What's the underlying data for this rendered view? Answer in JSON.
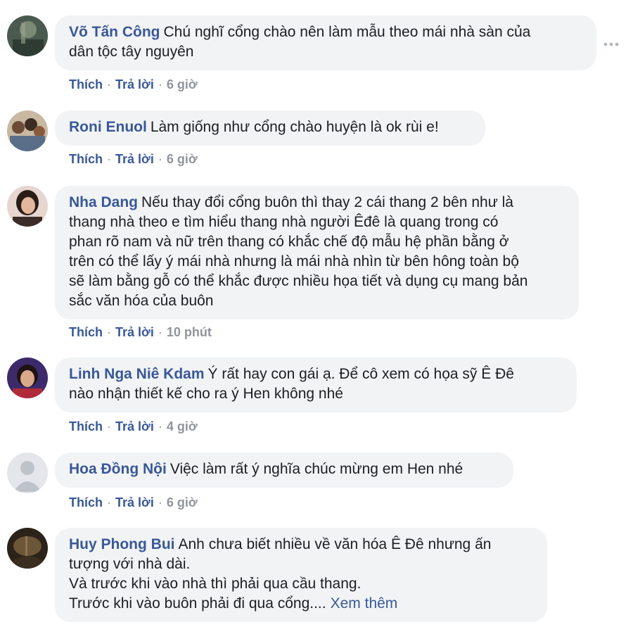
{
  "icons": {
    "more": "more-options-icon"
  },
  "colors": {
    "author": "#385898",
    "bubble": "#f2f3f5",
    "meta": "#90949c"
  },
  "comments": [
    {
      "author": "Võ Tấn Công",
      "text": "Chú nghĩ cổng chào nên làm mẫu theo mái nhà sàn của\ndân tộc tây nguyên",
      "like": "Thích",
      "reply": "Trả lời",
      "time": "6 giờ"
    },
    {
      "author": "Roni Enuol",
      "text": "Làm giống như cổng chào huyện là ok rùi e!",
      "like": "Thích",
      "reply": "Trả lời",
      "time": "6 giờ"
    },
    {
      "author": "Nha Dang",
      "text": "Nếu thay đổi cổng buôn thì thay 2 cái thang 2 bên như là\nthang nhà theo e tìm hiểu thang nhà người Êđê là quang trong có\nphan rõ nam và nữ trên thang có khắc chế độ mẫu hệ phần bằng ở\ntrên có thể lấy ý mái nhà nhưng là mái nhà nhìn từ bên hông toàn bộ\nsẽ làm bằng gỗ có thể khắc được nhiều họa tiết và dụng cụ mang bản\nsắc văn hóa của buôn",
      "like": "Thích",
      "reply": "Trả lời",
      "time": "10 phút"
    },
    {
      "author": "Linh Nga Niê Kdam",
      "text": "Ý rất hay con gái ạ. Để cô xem có họa sỹ Ê Đê\nnào nhận thiết kế cho ra ý Hen không nhé",
      "like": "Thích",
      "reply": "Trả lời",
      "time": "4 giờ"
    },
    {
      "author": "Hoa Đồng Nội",
      "text": "Việc làm rất ý nghĩa chúc mừng em Hen nhé",
      "like": "Thích",
      "reply": "Trả lời",
      "time": "6 giờ"
    },
    {
      "author": "Huy Phong Bui",
      "text": "Anh chưa biết nhiều về văn hóa Ê Đê nhưng ấn\ntượng với nhà dài.\nVà trước khi vào nhà thì phải qua cầu thang.\nTrước khi vào buôn phải đi qua cổng....",
      "see_more": "Xem thêm"
    }
  ]
}
